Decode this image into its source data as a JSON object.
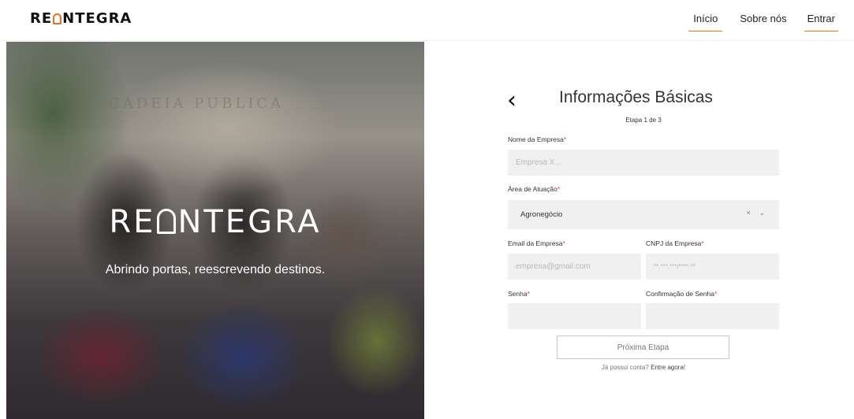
{
  "header": {
    "logo_left": "RE",
    "logo_right": "NTEGRA",
    "nav": [
      {
        "label": "Início"
      },
      {
        "label": "Sobre nós"
      },
      {
        "label": "Entrar"
      }
    ]
  },
  "hero": {
    "background_sign": "CADEIA PUBLICA",
    "logo_left": "RE",
    "logo_right": "NTEGRA",
    "tagline": "Abrindo portas, reescrevendo destinos."
  },
  "form": {
    "title": "Informações Básicas",
    "step": "Etapa 1 de 3",
    "fields": {
      "company_name": {
        "label": "Nome da Empresa",
        "required": "*",
        "placeholder": "Empresa X..."
      },
      "area": {
        "label": "Área de Atuação",
        "required": "*",
        "value": "Agronegócio",
        "clear": "×",
        "chevron": "⌄"
      },
      "email": {
        "label": "Email da Empresa",
        "required": "*",
        "placeholder": "empresa@gmail.com"
      },
      "cnpj": {
        "label": "CNPJ da Empresa",
        "required": "*",
        "placeholder": "**.***.***/****-**"
      },
      "password": {
        "label": "Senha",
        "required": "*",
        "placeholder": ""
      },
      "password_confirm": {
        "label": "Confirmação de Senha",
        "required": "*",
        "placeholder": ""
      }
    },
    "submit_label": "Próxima Etapa",
    "login_prefix": "Já possui conta? ",
    "login_link": "Entre agora!"
  },
  "colors": {
    "accent": "#e8711f",
    "required": "#e24a3b",
    "input_bg": "#f0f0f0"
  }
}
